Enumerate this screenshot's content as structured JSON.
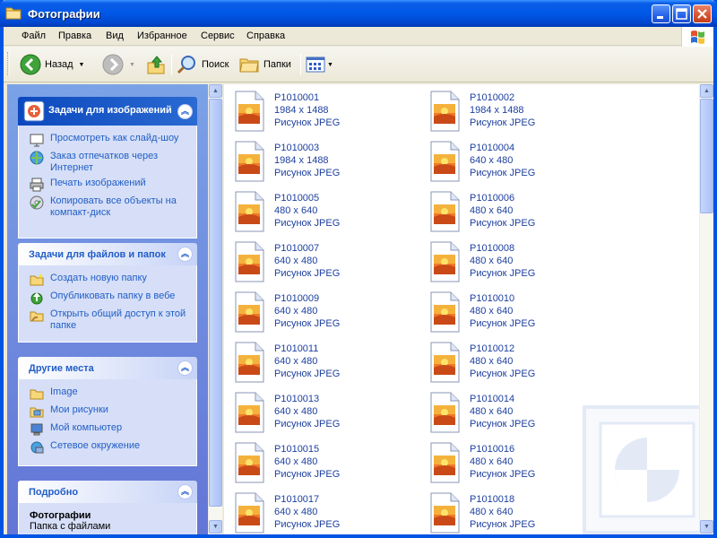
{
  "window": {
    "title": "Фотографии"
  },
  "menu": {
    "items": [
      "Файл",
      "Правка",
      "Вид",
      "Избранное",
      "Сервис",
      "Справка"
    ]
  },
  "toolbar": {
    "back_label": "Назад",
    "search_label": "Поиск",
    "folders_label": "Папки"
  },
  "task_pane": {
    "picture_tasks": {
      "title": "Задачи для изображений",
      "items": [
        "Просмотреть как слайд-шоу",
        "Заказ отпечатков через Интернет",
        "Печать изображений",
        "Копировать все объекты на компакт-диск"
      ]
    },
    "file_tasks": {
      "title": "Задачи для файлов и папок",
      "items": [
        "Создать новую папку",
        "Опубликовать папку в вебе",
        "Открыть общий доступ к этой папке"
      ]
    },
    "other_places": {
      "title": "Другие места",
      "items": [
        "Image",
        "Мои рисунки",
        "Мой компьютер",
        "Сетевое окружение"
      ]
    },
    "details": {
      "title": "Подробно",
      "name": "Фотографии",
      "type": "Папка с файлами"
    }
  },
  "files": [
    {
      "name": "P1010001",
      "dims": "1984 x 1488",
      "type": "Рисунок JPEG"
    },
    {
      "name": "P1010002",
      "dims": "1984 x 1488",
      "type": "Рисунок JPEG"
    },
    {
      "name": "P1010003",
      "dims": "1984 x 1488",
      "type": "Рисунок JPEG"
    },
    {
      "name": "P1010004",
      "dims": "640 x 480",
      "type": "Рисунок JPEG"
    },
    {
      "name": "P1010005",
      "dims": "480 x 640",
      "type": "Рисунок JPEG"
    },
    {
      "name": "P1010006",
      "dims": "480 x 640",
      "type": "Рисунок JPEG"
    },
    {
      "name": "P1010007",
      "dims": "640 x 480",
      "type": "Рисунок JPEG"
    },
    {
      "name": "P1010008",
      "dims": "480 x 640",
      "type": "Рисунок JPEG"
    },
    {
      "name": "P1010009",
      "dims": "640 x 480",
      "type": "Рисунок JPEG"
    },
    {
      "name": "P1010010",
      "dims": "480 x 640",
      "type": "Рисунок JPEG"
    },
    {
      "name": "P1010011",
      "dims": "640 x 480",
      "type": "Рисунок JPEG"
    },
    {
      "name": "P1010012",
      "dims": "480 x 640",
      "type": "Рисунок JPEG"
    },
    {
      "name": "P1010013",
      "dims": "640 x 480",
      "type": "Рисунок JPEG"
    },
    {
      "name": "P1010014",
      "dims": "480 x 640",
      "type": "Рисунок JPEG"
    },
    {
      "name": "P1010015",
      "dims": "640 x 480",
      "type": "Рисунок JPEG"
    },
    {
      "name": "P1010016",
      "dims": "480 x 640",
      "type": "Рисунок JPEG"
    },
    {
      "name": "P1010017",
      "dims": "640 x 480",
      "type": "Рисунок JPEG"
    },
    {
      "name": "P1010018",
      "dims": "480 x 640",
      "type": "Рисунок JPEG"
    }
  ]
}
